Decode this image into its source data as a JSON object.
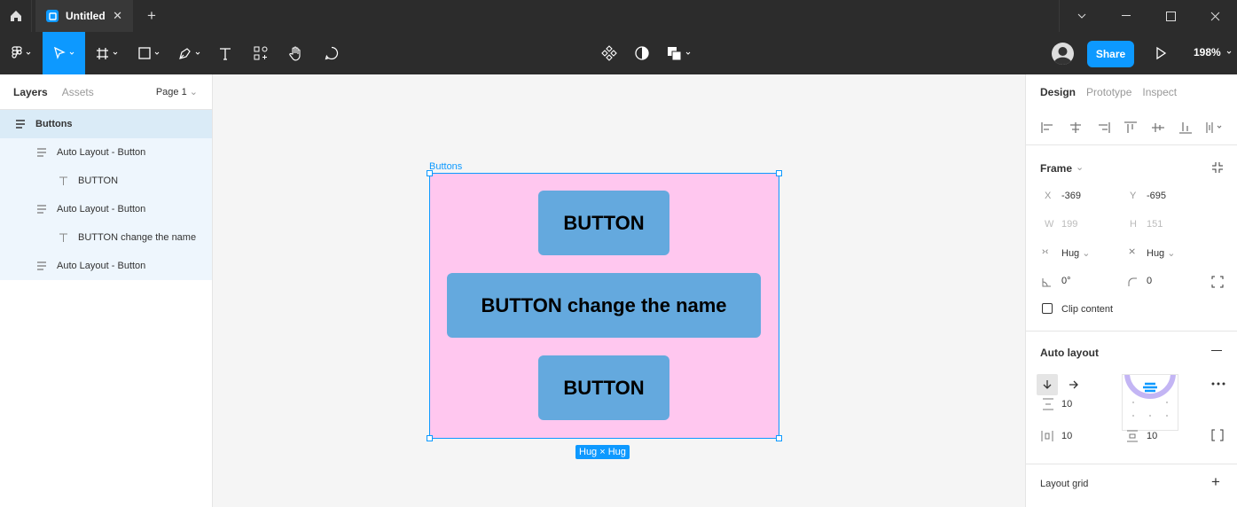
{
  "titlebar": {
    "tab_title": "Untitled"
  },
  "toolbar": {
    "share_label": "Share",
    "zoom": "198%"
  },
  "left_panel": {
    "tabs": [
      "Layers",
      "Assets"
    ],
    "page": "Page 1",
    "layers": [
      {
        "label": "Buttons",
        "type": "frame",
        "indent": 0
      },
      {
        "label": "Auto Layout - Button",
        "type": "frame",
        "indent": 1
      },
      {
        "label": "BUTTON",
        "type": "text",
        "indent": 2
      },
      {
        "label": "Auto Layout - Button",
        "type": "frame",
        "indent": 1
      },
      {
        "label": "BUTTON change the name",
        "type": "text",
        "indent": 2
      },
      {
        "label": "Auto Layout - Button",
        "type": "frame",
        "indent": 1
      }
    ]
  },
  "canvas": {
    "frame_label": "Buttons",
    "buttons": [
      "BUTTON",
      "BUTTON change the name",
      "BUTTON"
    ],
    "size_badge": "Hug × Hug",
    "frame_color": "#ffc7ef",
    "button_color": "#64a9de",
    "selection_color": "#0d99ff"
  },
  "right_panel": {
    "tabs": [
      "Design",
      "Prototype",
      "Inspect"
    ],
    "frame": {
      "title": "Frame",
      "x_label": "X",
      "x": "-369",
      "y_label": "Y",
      "y": "-695",
      "w_label": "W",
      "w": "199",
      "h_label": "H",
      "h": "151",
      "hug_h": "Hug",
      "hug_v": "Hug",
      "rotation": "0°",
      "radius": "0",
      "clip_label": "Clip content"
    },
    "auto_layout": {
      "title": "Auto layout",
      "spacing": "10",
      "padding_h": "10",
      "padding_v": "10"
    },
    "layout_grid": {
      "title": "Layout grid"
    }
  }
}
